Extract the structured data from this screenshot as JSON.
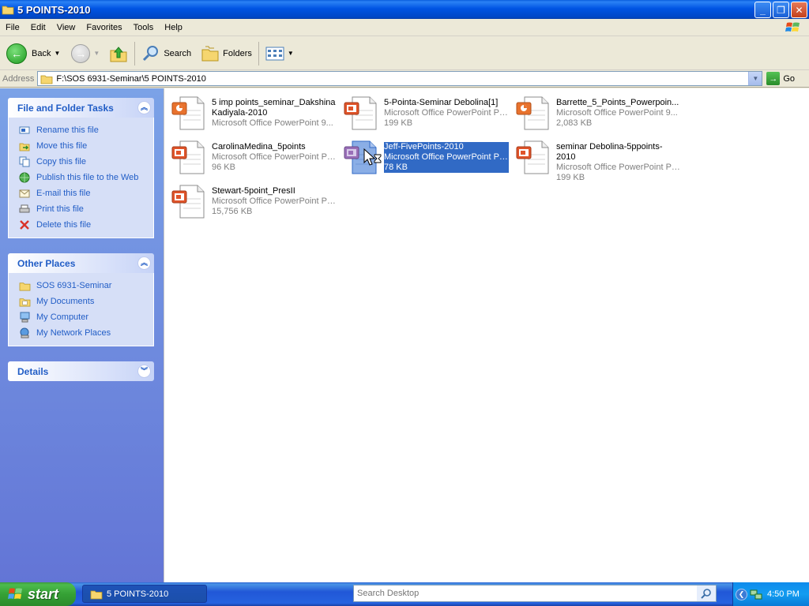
{
  "window": {
    "title": "5 POINTS-2010",
    "minimize": "_",
    "maximize": "❐",
    "close": "✕"
  },
  "menu": [
    "File",
    "Edit",
    "View",
    "Favorites",
    "Tools",
    "Help"
  ],
  "toolbar": {
    "back_label": "Back",
    "search_label": "Search",
    "folders_label": "Folders"
  },
  "address": {
    "label": "Address",
    "path": "F:\\SOS 6931-Seminar\\5 POINTS-2010",
    "go_label": "Go"
  },
  "file_tasks": {
    "title": "File and Folder Tasks",
    "items": [
      {
        "label": "Rename this file",
        "icon": "rename-icon"
      },
      {
        "label": "Move this file",
        "icon": "move-icon"
      },
      {
        "label": "Copy this file",
        "icon": "copy-icon"
      },
      {
        "label": "Publish this file to the Web",
        "icon": "globe-icon"
      },
      {
        "label": "E-mail this file",
        "icon": "email-icon"
      },
      {
        "label": "Print this file",
        "icon": "printer-icon"
      },
      {
        "label": "Delete this file",
        "icon": "delete-icon"
      }
    ]
  },
  "other_places": {
    "title": "Other Places",
    "items": [
      {
        "label": "SOS 6931-Seminar",
        "icon": "folder-icon"
      },
      {
        "label": "My Documents",
        "icon": "my-documents-icon"
      },
      {
        "label": "My Computer",
        "icon": "my-computer-icon"
      },
      {
        "label": "My Network Places",
        "icon": "network-places-icon"
      }
    ]
  },
  "details": {
    "title": "Details"
  },
  "files": [
    {
      "name": "5 imp points_seminar_Dakshina Kadiyala-2010",
      "type": "Microsoft Office PowerPoint 9...",
      "size": "",
      "selected": false
    },
    {
      "name": "5-Pointa-Seminar Debolina[1]",
      "type": "Microsoft Office PowerPoint Pr...",
      "size": "199 KB",
      "selected": false
    },
    {
      "name": "Barrette_5_Points_Powerpoin...",
      "type": "Microsoft Office PowerPoint 9...",
      "size": "2,083 KB",
      "selected": false
    },
    {
      "name": "CarolinaMedina_5points",
      "type": "Microsoft Office PowerPoint Pr...",
      "size": "96 KB",
      "selected": false
    },
    {
      "name": "Jeff-FivePoints-2010",
      "type": "Microsoft Office PowerPoint Pr...",
      "size": "78 KB",
      "selected": true
    },
    {
      "name": "seminar Debolina-5ppoints-2010",
      "type": "Microsoft Office PowerPoint Pr...",
      "size": "199 KB",
      "selected": false
    },
    {
      "name": "Stewart-5point_PresII",
      "type": "Microsoft Office PowerPoint Pr...",
      "size": "15,756 KB",
      "selected": false
    }
  ],
  "taskbar": {
    "start_label": "start",
    "window_button": "5 POINTS-2010",
    "search_placeholder": "Search Desktop",
    "clock": "4:50 PM"
  },
  "colors": {
    "titlebar_blue": "#0054E3",
    "task_link": "#215DC6",
    "selection": "#316AC5",
    "start_green": "#35A135"
  }
}
